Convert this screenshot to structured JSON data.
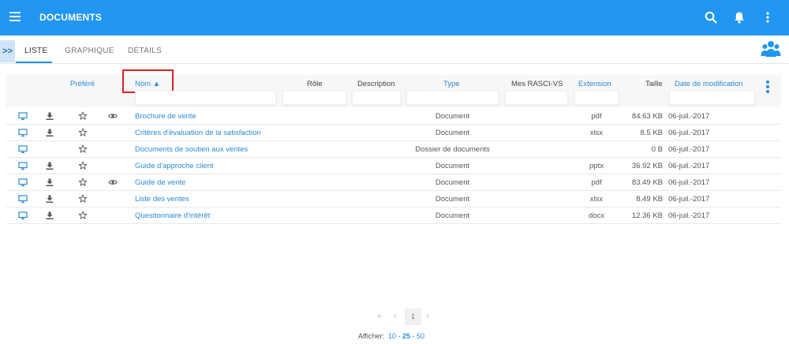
{
  "app": {
    "title": "DOCUMENTS"
  },
  "tabs": [
    {
      "label": "LISTE"
    },
    {
      "label": "GRAPHIQUE"
    },
    {
      "label": "DÉTAILS"
    }
  ],
  "expander": {
    "label": ">>"
  },
  "columns": {
    "prefere": "Préféré",
    "nom": "Nom ▲",
    "role": "Rôle",
    "description": "Description",
    "type": "Type",
    "rasci": "Mes RASCI-VS",
    "extension": "Extension",
    "taille": "Taille",
    "date": "Date de modification"
  },
  "rows": [
    {
      "name": "Brochure de vente",
      "type": "Document",
      "ext": "pdf",
      "size": "84.63 KB",
      "date": "06-juil.-2017",
      "download": true,
      "view": true
    },
    {
      "name": "Critères d'évaluation de la satisfaction",
      "type": "Document",
      "ext": "xlsx",
      "size": "8.5 KB",
      "date": "06-juil.-2017",
      "download": true,
      "view": false
    },
    {
      "name": "Documents de soutien aux ventes",
      "type": "Dossier de documents",
      "ext": "",
      "size": "0 B",
      "date": "06-juil.-2017",
      "download": false,
      "view": false
    },
    {
      "name": "Guide d'approche client",
      "type": "Document",
      "ext": "pptx",
      "size": "36.92 KB",
      "date": "06-juil.-2017",
      "download": true,
      "view": false
    },
    {
      "name": "Guide de vente",
      "type": "Document",
      "ext": "pdf",
      "size": "83.49 KB",
      "date": "06-juil.-2017",
      "download": true,
      "view": true
    },
    {
      "name": "Liste des ventes",
      "type": "Document",
      "ext": "xlsx",
      "size": "8.49 KB",
      "date": "06-juil.-2017",
      "download": true,
      "view": false
    },
    {
      "name": "Questionnaire d'intérêt",
      "type": "Document",
      "ext": "docx",
      "size": "12.36 KB",
      "date": "06-juil.-2017",
      "download": true,
      "view": false
    }
  ],
  "pagination": {
    "first": "«",
    "prev": "‹",
    "current": "1",
    "next": "›",
    "show_label": "Afficher:",
    "sizes": [
      "10",
      "25",
      "50"
    ],
    "separator": "-"
  },
  "colors": {
    "primary": "#2196f3",
    "link": "#2a8ad6",
    "highlight": "#e02020"
  }
}
